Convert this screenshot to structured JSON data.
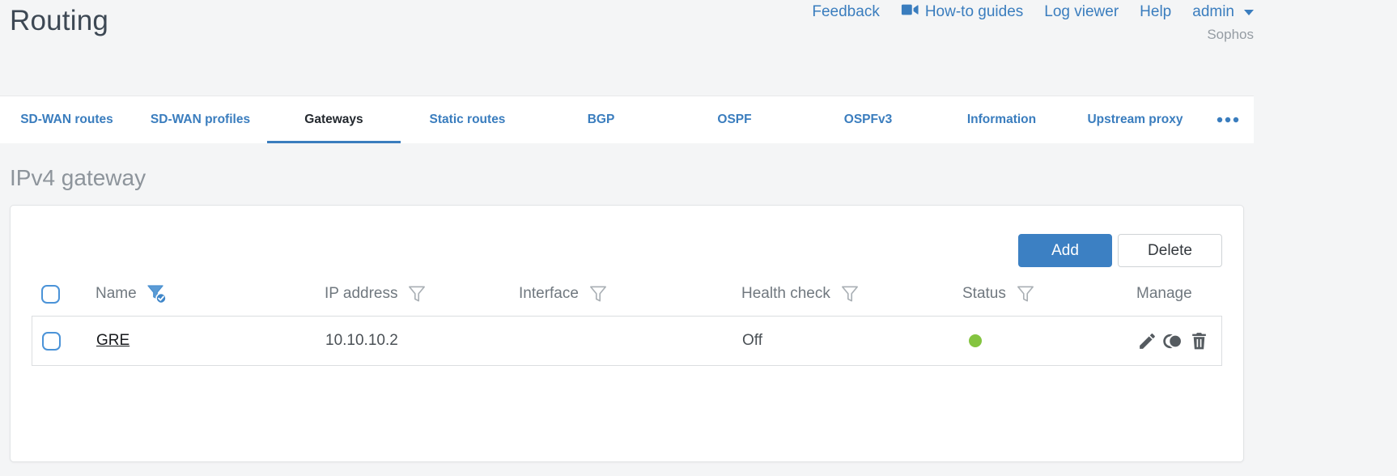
{
  "header": {
    "title": "Routing",
    "links": {
      "feedback": "Feedback",
      "howto": "How-to guides",
      "log_viewer": "Log viewer",
      "help": "Help"
    },
    "user_menu": {
      "label": "admin"
    },
    "brand": "Sophos"
  },
  "tabs": {
    "items": [
      {
        "label": "SD-WAN routes",
        "active": false
      },
      {
        "label": "SD-WAN profiles",
        "active": false
      },
      {
        "label": "Gateways",
        "active": true
      },
      {
        "label": "Static routes",
        "active": false
      },
      {
        "label": "BGP",
        "active": false
      },
      {
        "label": "OSPF",
        "active": false
      },
      {
        "label": "OSPFv3",
        "active": false
      },
      {
        "label": "Information",
        "active": false
      },
      {
        "label": "Upstream proxy",
        "active": false
      }
    ],
    "overflow_icon": "ellipsis-icon"
  },
  "section": {
    "title": "IPv4 gateway"
  },
  "toolbar": {
    "add_label": "Add",
    "delete_label": "Delete"
  },
  "table": {
    "columns": [
      {
        "label": "Name",
        "filter": "active"
      },
      {
        "label": "IP address",
        "filter": "inactive"
      },
      {
        "label": "Interface",
        "filter": "inactive"
      },
      {
        "label": "Health check",
        "filter": "inactive"
      },
      {
        "label": "Status",
        "filter": "inactive"
      },
      {
        "label": "Manage",
        "filter": "none"
      }
    ],
    "rows": [
      {
        "name": "GRE",
        "ip_address": "10.10.10.2",
        "interface": "",
        "health_check": "Off",
        "status": "up",
        "status_color": "#84c440",
        "manage_icons": [
          "edit-icon",
          "clone-icon",
          "delete-icon"
        ]
      }
    ]
  },
  "colors": {
    "accent_blue": "#3a7dbe",
    "active_filter_blue": "#5b9bd5",
    "status_green": "#84c440"
  }
}
